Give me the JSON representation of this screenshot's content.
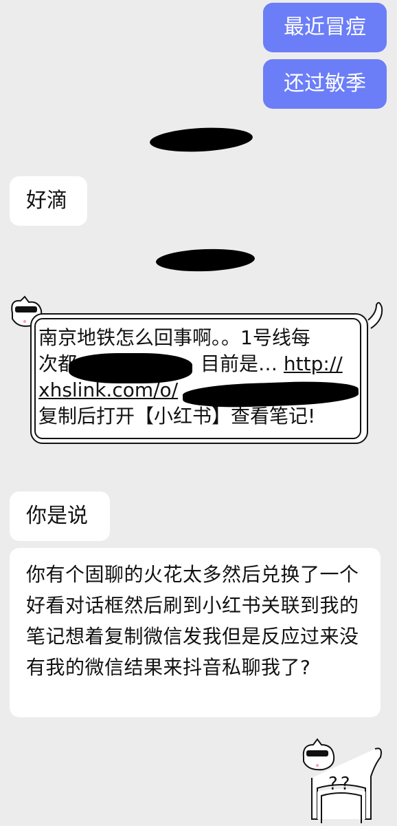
{
  "messages": {
    "me1": "最近冒痘",
    "me2": "还过敏季",
    "them1": "好滴",
    "card": {
      "line1": "南京地铁怎么回事啊。。1号线每",
      "line2_pre": "次都",
      "line2_post": "目前是… ",
      "line2_link": "http://",
      "line3": "xhslink.com/o/",
      "line4": "复制后打开【小红书】查看笔记!"
    },
    "them2": "你是说",
    "them3": "你有个固聊的火花太多然后兑换了一个好看对话框然后刷到小红书关联到我的笔记想着复制微信发我但是反应过来没有我的微信结果来抖音私聊我了?"
  },
  "sticker": {
    "text": "??"
  }
}
